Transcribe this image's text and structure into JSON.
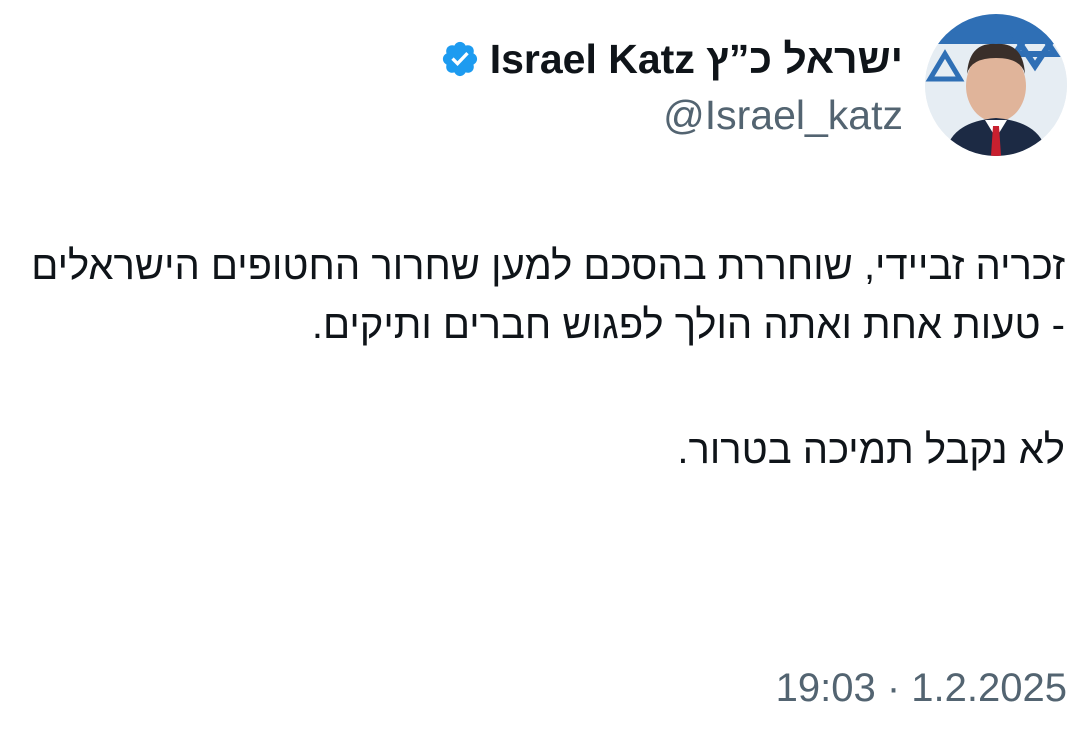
{
  "author": {
    "display_name": "ישראל כ”ץ Israel Katz",
    "handle": "@Israel_katz",
    "verified": true,
    "avatar_icon": "profile-photo",
    "verified_icon": "verified-badge-icon"
  },
  "tweet": {
    "paragraph_1": "זכריה זביידי, שוחררת בהסכם למען שחרור החטופים הישראלים - טעות אחת ואתה הולך לפגוש חברים ותיקים.",
    "paragraph_2": "לא נקבל תמיכה בטרור.",
    "timestamp": "19:03 · 1.2.2025"
  },
  "colors": {
    "text": "#0f1419",
    "secondary_text": "#536471",
    "verified_blue": "#1d9bf0",
    "background": "#ffffff"
  }
}
